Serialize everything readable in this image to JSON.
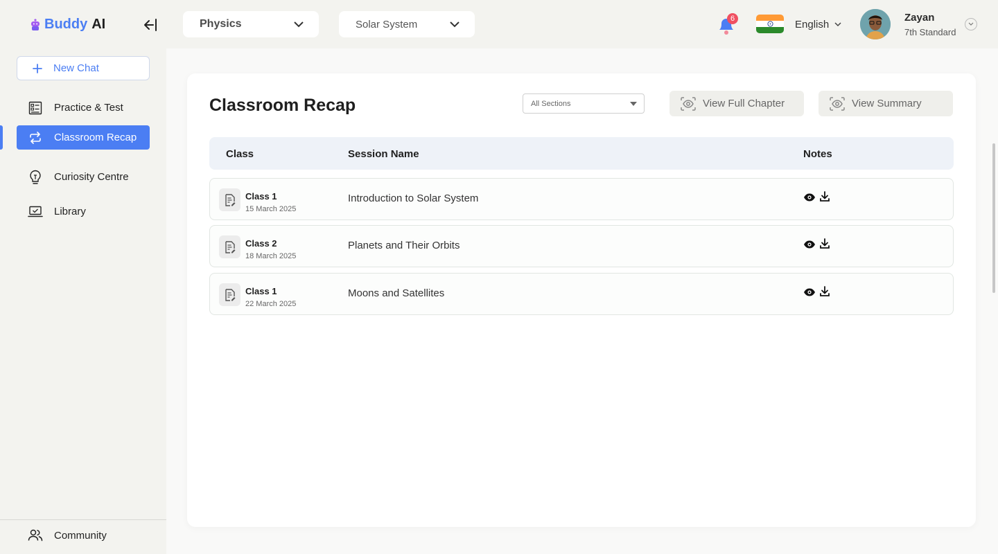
{
  "app": {
    "brand_first": "Buddy",
    "brand_second": "AI",
    "accent": "#4b7ef3"
  },
  "header": {
    "subject": "Physics",
    "chapter": "Solar System",
    "notification_count": "6",
    "language": "English",
    "user": {
      "name": "Zayan",
      "grade": "7th Standard"
    }
  },
  "sidebar": {
    "new_chat": "New Chat",
    "items": [
      {
        "label": "Practice & Test",
        "icon": "checklist-icon"
      },
      {
        "label": "Classroom Recap",
        "icon": "repeat-icon",
        "active": true
      },
      {
        "label": "Curiosity Centre",
        "icon": "lightbulb-icon"
      },
      {
        "label": "Library",
        "icon": "laptop-icon"
      }
    ],
    "footer": {
      "label": "Community",
      "icon": "people-icon"
    }
  },
  "main": {
    "title": "Classroom Recap",
    "section_filter": "All Sections",
    "view_full_chapter": "View Full Chapter",
    "view_summary": "View Summary",
    "columns": {
      "class": "Class",
      "session": "Session Name",
      "notes": "Notes"
    },
    "rows": [
      {
        "class": "Class 1",
        "date": "15 March 2025",
        "session": "Introduction to Solar System"
      },
      {
        "class": "Class 2",
        "date": "18 March 2025",
        "session": "Planets and Their Orbits"
      },
      {
        "class": "Class 1",
        "date": "22 March 2025",
        "session": "Moons and Satellites"
      }
    ]
  }
}
